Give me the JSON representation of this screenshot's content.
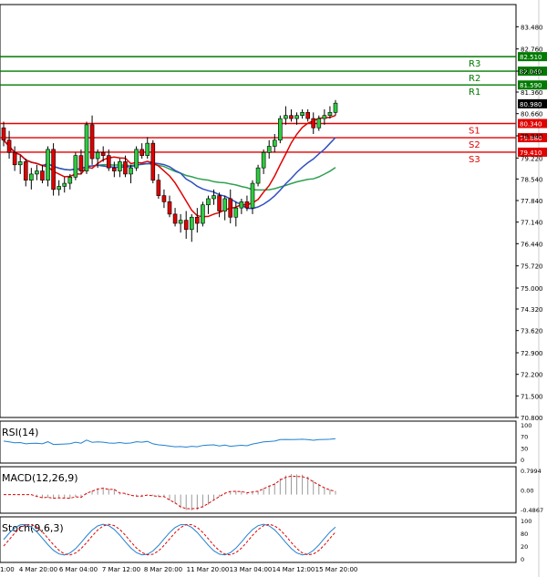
{
  "chart_data": {
    "type": "candlestick",
    "instrument_note": "",
    "main": {
      "ylim": [
        70.8,
        84.2
      ],
      "y_ticks": [
        "83.480",
        "82.760",
        "82.040",
        "81.360",
        "80.660",
        "79.940",
        "79.220",
        "78.540",
        "77.840",
        "77.140",
        "76.440",
        "75.720",
        "75.000",
        "74.320",
        "73.620",
        "72.900",
        "72.200",
        "71.500",
        "70.800"
      ],
      "levels": [
        {
          "name": "R3",
          "value": 82.51,
          "label": "82.510",
          "color": "#007a00"
        },
        {
          "name": "R2",
          "value": 82.04,
          "label": "82.040",
          "color": "#007a00"
        },
        {
          "name": "R1",
          "value": 81.59,
          "label": "81.590",
          "color": "#007a00"
        },
        {
          "name": "S1",
          "value": 80.34,
          "label": "80.340",
          "color": "#e00000"
        },
        {
          "name": "S2",
          "value": 79.88,
          "label": "79.880",
          "color": "#e00000"
        },
        {
          "name": "S3",
          "value": 79.41,
          "label": "79.410",
          "color": "#e00000"
        }
      ],
      "current_price": {
        "value": 80.98,
        "label": "80.980"
      },
      "candles": [
        [
          80.2,
          80.4,
          79.6,
          79.8
        ],
        [
          79.8,
          80.1,
          79.2,
          79.4
        ],
        [
          79.4,
          79.6,
          78.8,
          79.0
        ],
        [
          79.0,
          79.3,
          78.7,
          79.1
        ],
        [
          79.1,
          79.2,
          78.3,
          78.5
        ],
        [
          78.5,
          78.9,
          78.2,
          78.7
        ],
        [
          78.7,
          79.0,
          78.5,
          78.8
        ],
        [
          78.8,
          79.0,
          78.4,
          78.5
        ],
        [
          78.5,
          79.6,
          78.3,
          79.5
        ],
        [
          79.5,
          79.7,
          78.0,
          78.2
        ],
        [
          78.2,
          78.5,
          78.0,
          78.3
        ],
        [
          78.3,
          78.6,
          78.1,
          78.4
        ],
        [
          78.4,
          78.7,
          78.2,
          78.6
        ],
        [
          78.6,
          79.4,
          78.5,
          79.3
        ],
        [
          79.3,
          79.5,
          78.7,
          78.8
        ],
        [
          78.8,
          80.4,
          78.7,
          80.3
        ],
        [
          80.3,
          80.6,
          79.0,
          79.2
        ],
        [
          79.2,
          79.5,
          78.9,
          79.4
        ],
        [
          79.4,
          79.6,
          79.1,
          79.3
        ],
        [
          79.3,
          79.5,
          78.8,
          78.9
        ],
        [
          78.9,
          79.1,
          78.6,
          78.8
        ],
        [
          78.8,
          79.2,
          78.6,
          79.1
        ],
        [
          79.1,
          79.3,
          78.6,
          78.7
        ],
        [
          78.7,
          79.0,
          78.4,
          78.9
        ],
        [
          78.9,
          79.6,
          78.8,
          79.5
        ],
        [
          79.5,
          79.7,
          79.2,
          79.3
        ],
        [
          79.3,
          79.9,
          79.2,
          79.7
        ],
        [
          79.7,
          79.8,
          78.4,
          78.5
        ],
        [
          78.5,
          78.7,
          77.9,
          78.0
        ],
        [
          78.0,
          78.2,
          77.6,
          77.8
        ],
        [
          77.8,
          78.0,
          77.3,
          77.4
        ],
        [
          77.4,
          77.6,
          77.0,
          77.1
        ],
        [
          77.1,
          77.4,
          76.8,
          77.2
        ],
        [
          77.2,
          77.5,
          76.6,
          76.9
        ],
        [
          76.9,
          77.4,
          76.5,
          77.3
        ],
        [
          77.3,
          77.6,
          76.8,
          77.1
        ],
        [
          77.1,
          77.8,
          77.0,
          77.7
        ],
        [
          77.7,
          78.0,
          77.4,
          77.9
        ],
        [
          77.9,
          78.2,
          77.7,
          78.0
        ],
        [
          78.0,
          78.1,
          77.3,
          77.5
        ],
        [
          77.5,
          78.0,
          77.2,
          77.9
        ],
        [
          77.9,
          78.2,
          77.1,
          77.3
        ],
        [
          77.3,
          77.8,
          77.0,
          77.6
        ],
        [
          77.6,
          77.9,
          77.4,
          77.8
        ],
        [
          77.8,
          78.0,
          77.5,
          77.6
        ],
        [
          77.6,
          78.5,
          77.4,
          78.4
        ],
        [
          78.4,
          79.0,
          78.3,
          78.9
        ],
        [
          78.9,
          79.5,
          78.7,
          79.4
        ],
        [
          79.4,
          79.8,
          79.2,
          79.6
        ],
        [
          79.6,
          80.0,
          79.4,
          79.8
        ],
        [
          79.8,
          80.6,
          79.7,
          80.5
        ],
        [
          80.5,
          80.9,
          80.3,
          80.6
        ],
        [
          80.6,
          80.8,
          80.4,
          80.5
        ],
        [
          80.5,
          80.7,
          80.3,
          80.6
        ],
        [
          80.6,
          80.8,
          80.5,
          80.7
        ],
        [
          80.7,
          80.8,
          80.4,
          80.5
        ],
        [
          80.5,
          80.7,
          80.0,
          80.2
        ],
        [
          80.2,
          80.6,
          80.1,
          80.5
        ],
        [
          80.5,
          80.8,
          80.3,
          80.6
        ],
        [
          80.6,
          80.9,
          80.5,
          80.7
        ],
        [
          80.7,
          81.1,
          80.6,
          81.0
        ]
      ]
    },
    "indicators": [
      {
        "name": "RSI(14)",
        "ticks": [
          "100",
          "70",
          "30",
          "0"
        ]
      },
      {
        "name": "MACD(12,26,9)",
        "ticks": [
          "0.7994",
          "0.00",
          "-0.4867"
        ]
      },
      {
        "name": "Stoch(9,6,3)",
        "ticks": [
          "100",
          "80",
          "20",
          "0"
        ]
      }
    ],
    "x_ticks": [
      "1:00",
      "4 Mar 20:00",
      "6 Mar 04:00",
      "7 Mar 12:00",
      "8 Mar 20:00",
      "11 Mar 20:00",
      "13 Mar 04:00",
      "14 Mar 12:00",
      "15 Mar 20:00"
    ],
    "colors": {
      "ma_fast": "#e00000",
      "ma_mid": "#3050c0",
      "ma_slow": "#30a050",
      "indicator": "#2080d0",
      "signal": "#e00000"
    }
  }
}
